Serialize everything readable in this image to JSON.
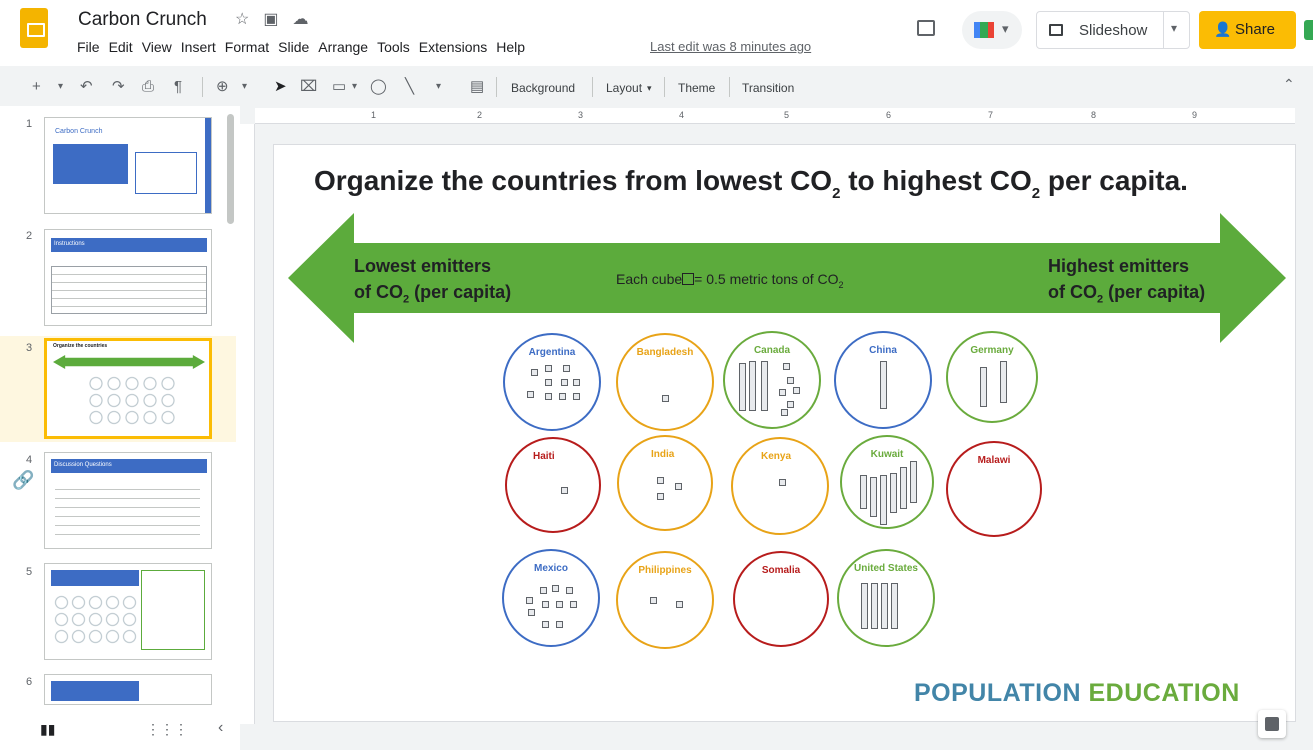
{
  "app": {
    "doc_title": "Carbon Crunch",
    "menu": [
      "File",
      "Edit",
      "View",
      "Insert",
      "Format",
      "Slide",
      "Arrange",
      "Tools",
      "Extensions",
      "Help"
    ],
    "last_edit": "Last edit was 8 minutes ago",
    "slideshow_label": "Slideshow",
    "share_label": "Share"
  },
  "toolbar": {
    "background_label": "Background",
    "layout_label": "Layout",
    "theme_label": "Theme",
    "transition_label": "Transition"
  },
  "ruler": [
    "1",
    "2",
    "3",
    "4",
    "5",
    "6",
    "7",
    "8",
    "9"
  ],
  "filmstrip": {
    "slides": [
      {
        "num": "1",
        "title": "Carbon Crunch"
      },
      {
        "num": "2",
        "title": "Instructions"
      },
      {
        "num": "3",
        "title": "Organize the countries"
      },
      {
        "num": "4",
        "title": "Discussion Questions"
      },
      {
        "num": "5",
        "title": ""
      },
      {
        "num": "6",
        "title": ""
      }
    ],
    "selected": "3"
  },
  "slide": {
    "title_part1": "Organize the countries from lowest CO",
    "title_sub": "2",
    "title_part2": " to highest CO",
    "title_part3": " per capita.",
    "low_label_1": "Lowest emitters",
    "low_label_2": "of CO",
    "low_label_3": " (per capita)",
    "high_label_1": "Highest emitters",
    "high_label_2": "of CO",
    "high_label_3": " (per capita)",
    "cube_note_1": "Each cube",
    "cube_note_2": "= 0.5 metric tons of CO",
    "cube_note_sub": "2",
    "arrow_color": "#5cab3c",
    "countries": [
      {
        "name": "Argentina",
        "color": "#3d6cc4"
      },
      {
        "name": "Bangladesh",
        "color": "#e8a317"
      },
      {
        "name": "Canada",
        "color": "#6aab3d"
      },
      {
        "name": "China",
        "color": "#3d6cc4"
      },
      {
        "name": "Germany",
        "color": "#6aab3d"
      },
      {
        "name": "Haiti",
        "color": "#b71c1c"
      },
      {
        "name": "India",
        "color": "#e8a317"
      },
      {
        "name": "Kenya",
        "color": "#e8a317"
      },
      {
        "name": "Kuwait",
        "color": "#6aab3d"
      },
      {
        "name": "Malawi",
        "color": "#b71c1c"
      },
      {
        "name": "Mexico",
        "color": "#3d6cc4"
      },
      {
        "name": "Philippines",
        "color": "#e8a317"
      },
      {
        "name": "Somalia",
        "color": "#b71c1c"
      },
      {
        "name": "United States",
        "color": "#6aab3d"
      }
    ],
    "logo_part1": "POPULATION",
    "logo_part2": " EDUCATION"
  }
}
